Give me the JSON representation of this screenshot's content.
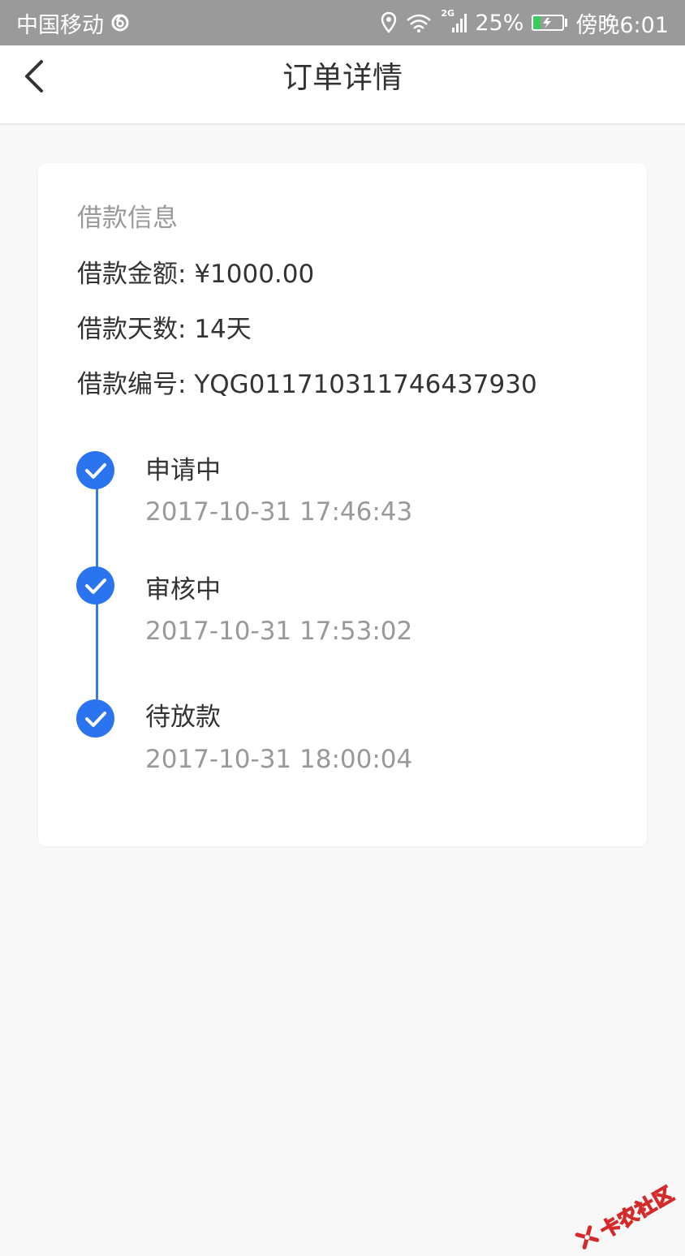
{
  "status_bar": {
    "carrier": "中国移动",
    "network_badge": "2G",
    "battery_percent": "25%",
    "battery_level": 0.25,
    "time": "傍晚6:01",
    "icons": [
      "netease-icon",
      "location-icon",
      "wifi-icon",
      "signal-icon",
      "battery-icon"
    ]
  },
  "nav": {
    "title": "订单详情",
    "back_icon": "chevron-left-icon"
  },
  "loan_info": {
    "section_title": "借款信息",
    "amount_label": "借款金额:",
    "amount_value": "¥1000.00",
    "days_label": "借款天数:",
    "days_value": "14天",
    "id_label": "借款编号:",
    "id_value": "YQG011710311746437930"
  },
  "timeline": {
    "accent_color": "#2b74f0",
    "steps": [
      {
        "label": "申请中",
        "time": "2017-10-31 17:46:43"
      },
      {
        "label": "审核中",
        "time": "2017-10-31 17:53:02"
      },
      {
        "label": "待放款",
        "time": "2017-10-31 18:00:04"
      }
    ]
  },
  "watermark": {
    "text": "卡农社区"
  }
}
